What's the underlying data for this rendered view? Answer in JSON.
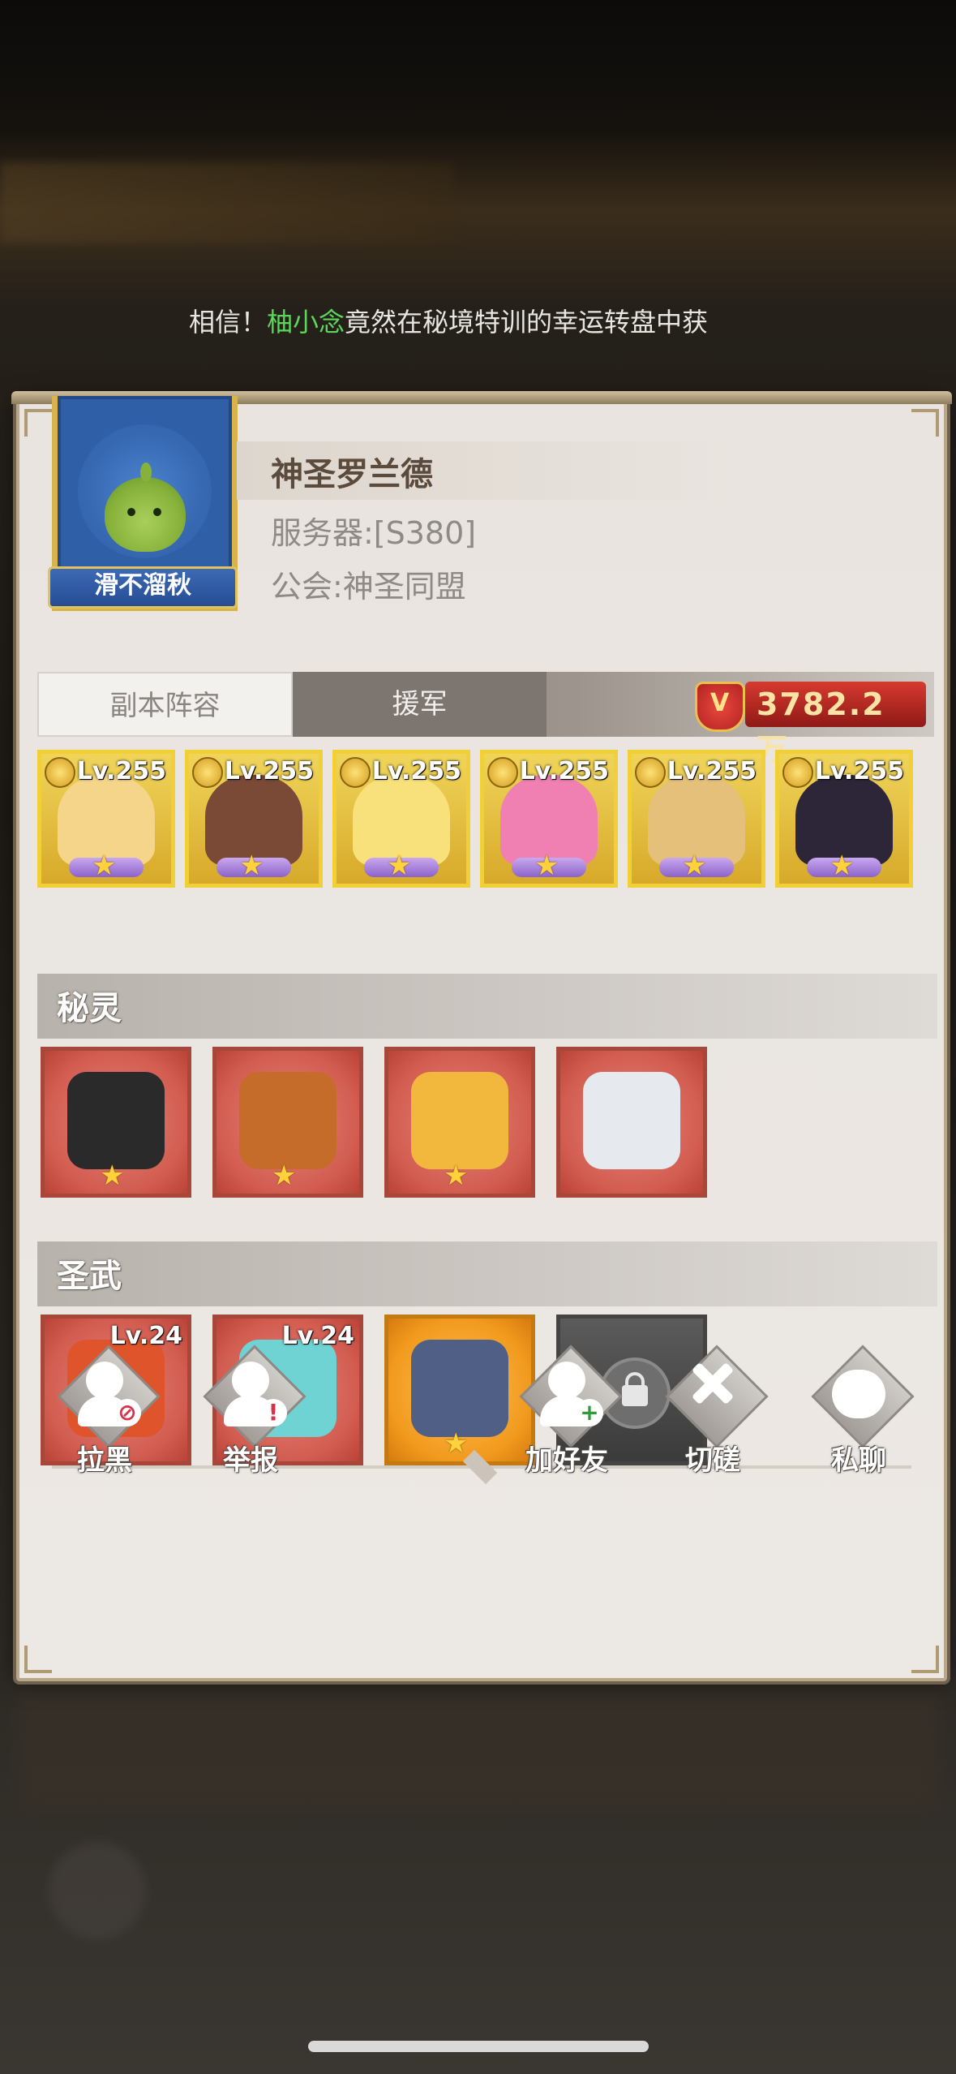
{
  "ticker": {
    "prefix": "相信！",
    "name": "柚小念",
    "text": "竟然在秘境特训的幸运转盘中获"
  },
  "profile": {
    "avatar_caption": "滑不溜秋",
    "player_name": "神圣罗兰德",
    "server": "服务器:[S380]",
    "guild": "公会:神圣同盟"
  },
  "tabs": [
    {
      "label": "副本阵容"
    },
    {
      "label": "援军"
    }
  ],
  "combat_power": "3782.2万",
  "heroes": [
    {
      "level": "Lv.255",
      "stars": 1,
      "color": "#f5d58a"
    },
    {
      "level": "Lv.255",
      "stars": 1,
      "color": "#7a4a36"
    },
    {
      "level": "Lv.255",
      "stars": 1,
      "color": "#f8e07a"
    },
    {
      "level": "Lv.255",
      "stars": 1,
      "color": "#f07fb2"
    },
    {
      "level": "Lv.255",
      "stars": 1,
      "color": "#e5c07a"
    },
    {
      "level": "Lv.255",
      "stars": 1,
      "color": "#2c2638"
    }
  ],
  "spirits": {
    "title": "秘灵",
    "items": [
      {
        "stars": 1,
        "color": "#2a2a2a"
      },
      {
        "stars": 1,
        "color": "#c56c2a"
      },
      {
        "stars": 1,
        "color": "#f2b73d"
      },
      {
        "stars": 0,
        "color": "#e6e9ee"
      }
    ]
  },
  "weapons": {
    "title": "圣武",
    "items": [
      {
        "level": "Lv.24",
        "color": "#e0542c"
      },
      {
        "level": "Lv.24",
        "color": "#6fd3d4"
      },
      {
        "level": "",
        "stars": 1,
        "color": "#4f5f86"
      },
      {
        "locked": true
      }
    ]
  },
  "actions": [
    {
      "label": "拉黑",
      "mark": "⊘",
      "mark_color": "#d9304a"
    },
    {
      "label": "举报",
      "mark": "!",
      "mark_color": "#d9304a"
    },
    {
      "label": "加好友",
      "mark": "+",
      "mark_color": "#2e9c3a"
    },
    {
      "label": "切磋",
      "mark": "",
      "mark_color": ""
    },
    {
      "label": "私聊",
      "mark": "",
      "mark_color": ""
    }
  ]
}
